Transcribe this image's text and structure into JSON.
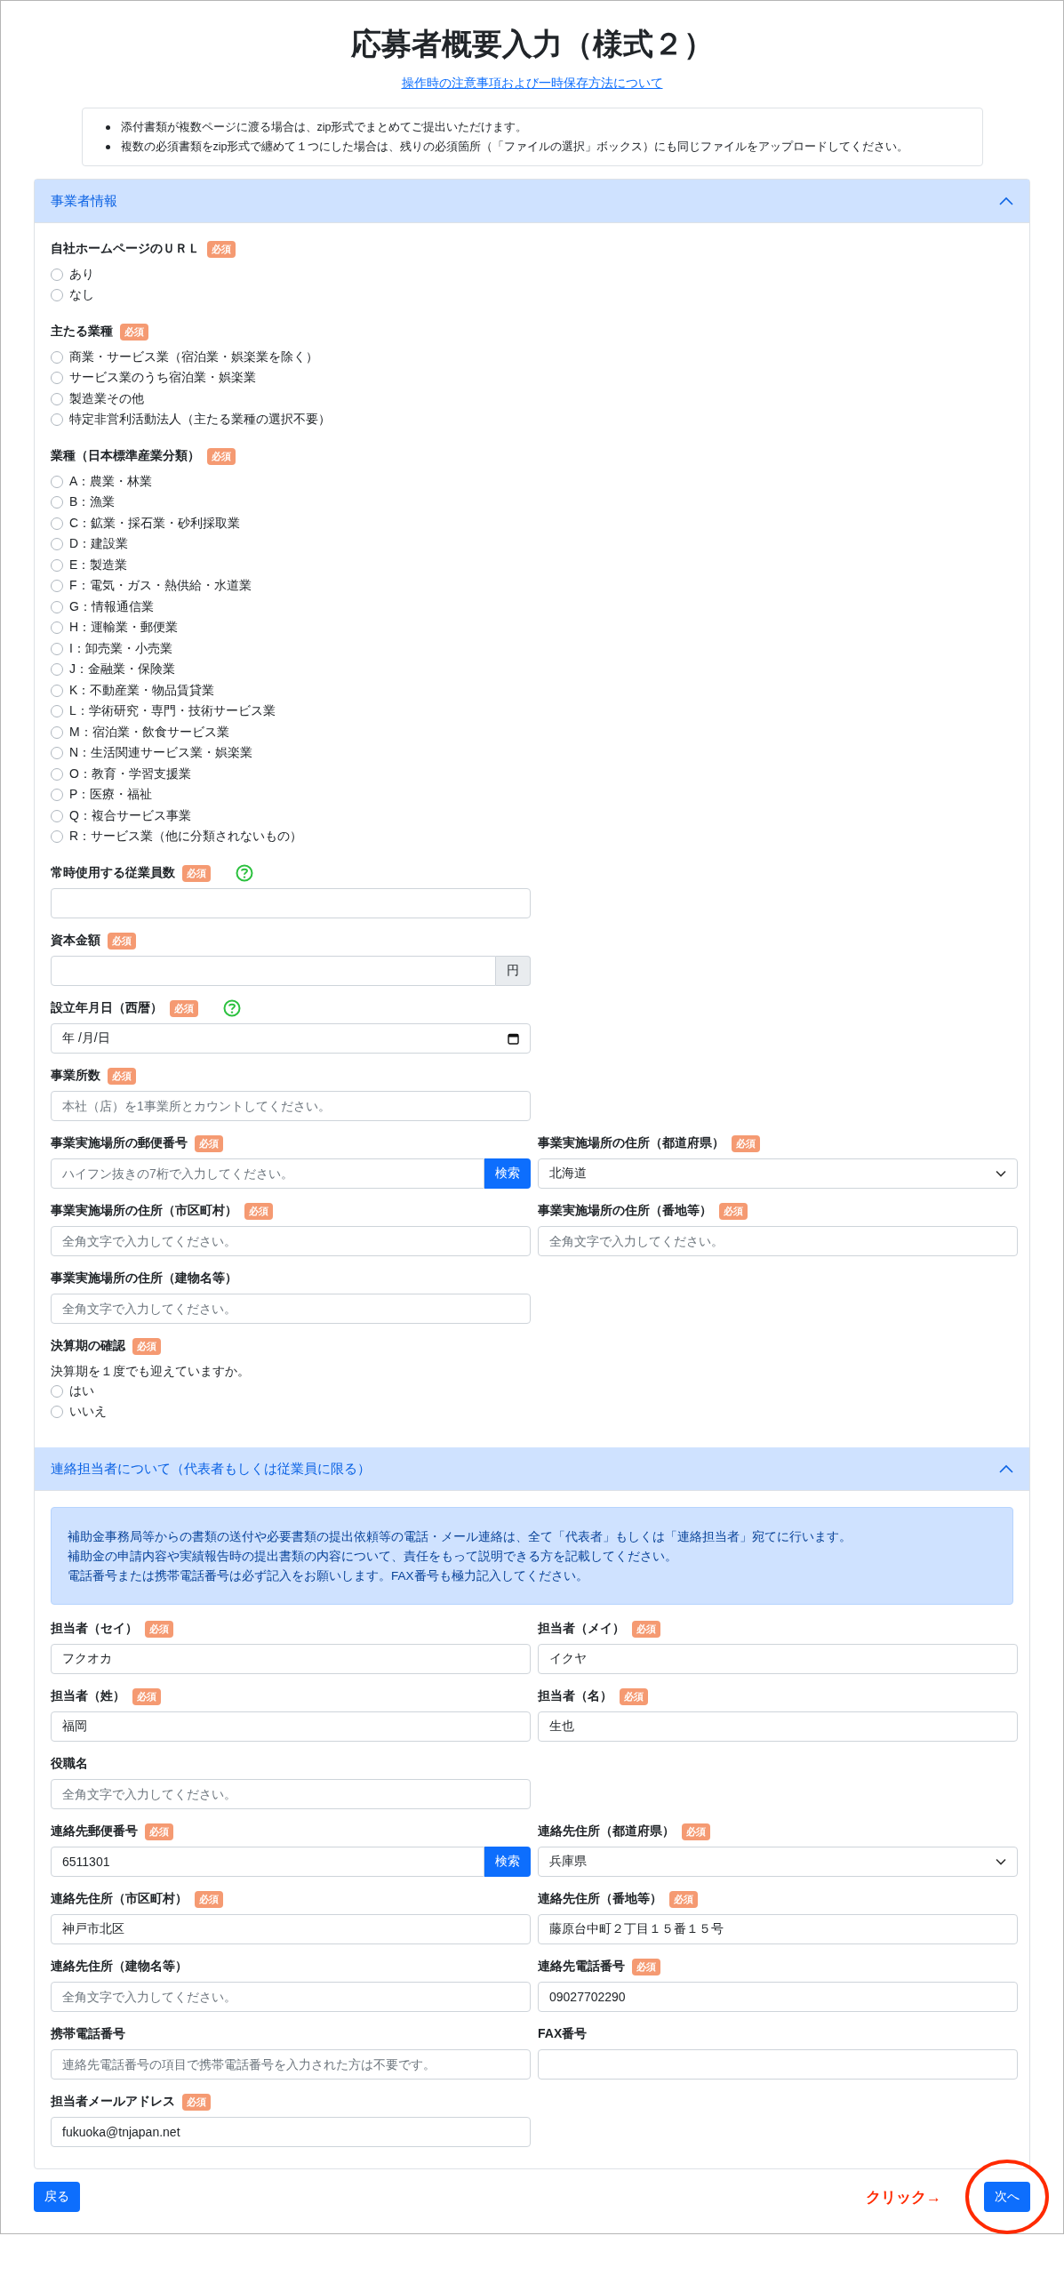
{
  "title": "応募者概要入力（様式２）",
  "guide_link": "操作時の注意事項および一時保存方法について",
  "notices": [
    "添付書類が複数ページに渡る場合は、zip形式でまとめてご提出いただけます。",
    "複数の必須書類をzip形式で纏めて１つにした場合は、残りの必須箇所（「ファイルの選択」ボックス）にも同じファイルをアップロードしてください。"
  ],
  "sections": [
    {
      "title": "事業者情報",
      "expanded": true,
      "rows": [
        [
          {
            "label": "自社ホームページのＵＲＬ",
            "badge": "必須",
            "help": false,
            "kind": "radio",
            "options": [
              {
                "label": "あり",
                "selected": false
              },
              {
                "label": "なし",
                "selected": false
              }
            ]
          }
        ],
        [
          {
            "label": "主たる業種",
            "badge": "必須",
            "help": false,
            "kind": "radio",
            "options": [
              {
                "label": "商業・サービス業（宿泊業・娯楽業を除く）",
                "selected": false
              },
              {
                "label": "サービス業のうち宿泊業・娯楽業",
                "selected": false
              },
              {
                "label": "製造業その他",
                "selected": false
              },
              {
                "label": "特定非営利活動法人（主たる業種の選択不要）",
                "selected": false
              }
            ]
          }
        ],
        [
          {
            "label": "業種（日本標準産業分類）",
            "badge": "必須",
            "help": false,
            "kind": "radio",
            "options": [
              {
                "label": "A：農業・林業",
                "selected": false
              },
              {
                "label": "B：漁業",
                "selected": false
              },
              {
                "label": "C：鉱業・採石業・砂利採取業",
                "selected": false
              },
              {
                "label": "D：建設業",
                "selected": false
              },
              {
                "label": "E：製造業",
                "selected": false
              },
              {
                "label": "F：電気・ガス・熱供給・水道業",
                "selected": false
              },
              {
                "label": "G：情報通信業",
                "selected": false
              },
              {
                "label": "H：運輸業・郵便業",
                "selected": false
              },
              {
                "label": "I：卸売業・小売業",
                "selected": false
              },
              {
                "label": "J：金融業・保険業",
                "selected": false
              },
              {
                "label": "K：不動産業・物品賃貸業",
                "selected": false
              },
              {
                "label": "L：学術研究・専門・技術サービス業",
                "selected": false
              },
              {
                "label": "M：宿泊業・飲食サービス業",
                "selected": false
              },
              {
                "label": "N：生活関連サービス業・娯楽業",
                "selected": false
              },
              {
                "label": "O：教育・学習支援業",
                "selected": false
              },
              {
                "label": "P：医療・福祉",
                "selected": false
              },
              {
                "label": "Q：複合サービス事業",
                "selected": false
              },
              {
                "label": "R：サービス業（他に分類されないもの）",
                "selected": false
              }
            ]
          }
        ],
        [
          {
            "label": "常時使用する従業員数",
            "badge": "必須",
            "help": true,
            "kind": "text"
          }
        ],
        [
          {
            "label": "資本金額",
            "badge": "必須",
            "help": false,
            "kind": "suffix",
            "suffix": "円"
          }
        ],
        [
          {
            "label": "設立年月日（西暦）",
            "badge": "必須",
            "help": true,
            "kind": "date",
            "value": "年 /月/日"
          }
        ],
        [
          {
            "label": "事業所数",
            "badge": "必須",
            "help": false,
            "kind": "text",
            "placeholder": "本社（店）を1事業所とカウントしてください。"
          }
        ],
        [
          {
            "label": "事業実施場所の郵便番号",
            "badge": "必須",
            "help": false,
            "kind": "postal",
            "placeholder": "ハイフン抜きの7桁で入力してください。",
            "button": "検索"
          },
          {
            "label": "事業実施場所の住所（都道府県）",
            "badge": "必須",
            "help": false,
            "kind": "select",
            "value": "北海道"
          }
        ],
        [
          {
            "label": "事業実施場所の住所（市区町村）",
            "badge": "必須",
            "help": false,
            "kind": "text",
            "placeholder": "全角文字で入力してください。"
          },
          {
            "label": "事業実施場所の住所（番地等）",
            "badge": "必須",
            "help": false,
            "kind": "text",
            "placeholder": "全角文字で入力してください。"
          }
        ],
        [
          {
            "label": "事業実施場所の住所（建物名等）",
            "help": false,
            "kind": "text",
            "placeholder": "全角文字で入力してください。"
          }
        ],
        [
          {
            "label": "決算期の確認",
            "badge": "必須",
            "help": false,
            "kind": "radio",
            "note": "決算期を１度でも迎えていますか。",
            "options": [
              {
                "label": "はい",
                "selected": false
              },
              {
                "label": "いいえ",
                "selected": false
              }
            ]
          }
        ]
      ]
    },
    {
      "title": "連絡担当者について（代表者もしくは従業員に限る）",
      "expanded": true,
      "info": [
        "補助金事務局等からの書類の送付や必要書類の提出依頼等の電話・メール連絡は、全て「代表者」もしくは「連絡担当者」宛てに行います。",
        "補助金の申請内容や実績報告時の提出書類の内容について、責任をもって説明できる方を記載してください。",
        "電話番号または携帯電話番号は必ず記入をお願いします。FAX番号も極力記入してください。"
      ],
      "rows": [
        [
          {
            "label": "担当者（セイ）",
            "badge": "必須",
            "help": false,
            "kind": "text",
            "value": "フクオカ"
          },
          {
            "label": "担当者（メイ）",
            "badge": "必須",
            "help": false,
            "kind": "text",
            "value": "イクヤ"
          }
        ],
        [
          {
            "label": "担当者（姓）",
            "badge": "必須",
            "help": false,
            "kind": "text",
            "value": "福岡"
          },
          {
            "label": "担当者（名）",
            "badge": "必須",
            "help": false,
            "kind": "text",
            "value": "生也"
          }
        ],
        [
          {
            "label": "役職名",
            "help": false,
            "kind": "text",
            "placeholder": "全角文字で入力してください。"
          }
        ],
        [
          {
            "label": "連絡先郵便番号",
            "badge": "必須",
            "help": false,
            "kind": "postal",
            "value": "6511301",
            "button": "検索"
          },
          {
            "label": "連絡先住所（都道府県）",
            "badge": "必須",
            "help": false,
            "kind": "select",
            "value": "兵庫県"
          }
        ],
        [
          {
            "label": "連絡先住所（市区町村）",
            "badge": "必須",
            "help": false,
            "kind": "text",
            "value": "神戸市北区"
          },
          {
            "label": "連絡先住所（番地等）",
            "badge": "必須",
            "help": false,
            "kind": "text",
            "value": "藤原台中町２丁目１５番１５号"
          }
        ],
        [
          {
            "label": "連絡先住所（建物名等）",
            "help": false,
            "kind": "text",
            "placeholder": "全角文字で入力してください。"
          },
          {
            "label": "連絡先電話番号",
            "badge": "必須",
            "help": false,
            "kind": "text",
            "value": "09027702290"
          }
        ],
        [
          {
            "label": "携帯電話番号",
            "help": false,
            "kind": "text",
            "placeholder": "連絡先電話番号の項目で携帯電話番号を入力された方は不要です。"
          },
          {
            "label": "FAX番号",
            "help": false,
            "kind": "text"
          }
        ],
        [
          {
            "label": "担当者メールアドレス",
            "badge": "必須",
            "help": false,
            "kind": "text",
            "value": "fukuoka@tnjapan.net"
          }
        ]
      ]
    }
  ],
  "footer": {
    "back": "戻る",
    "annotation": "クリック→",
    "next": {
      "label": "次へ",
      "highlighted": true
    }
  }
}
